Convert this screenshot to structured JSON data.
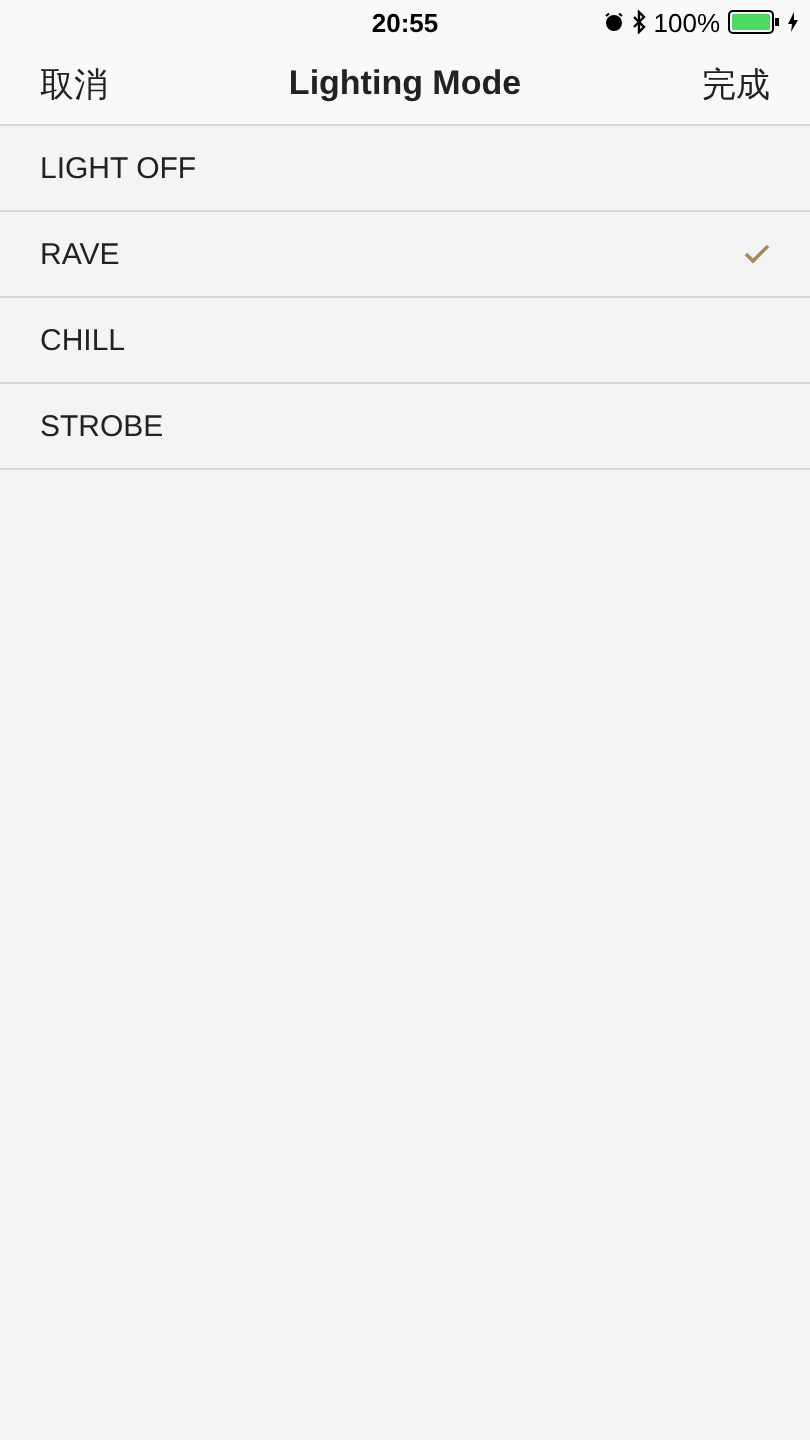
{
  "status_bar": {
    "time": "20:55",
    "battery": "100%",
    "alarm": true,
    "bluetooth": true,
    "charging": true
  },
  "nav": {
    "cancel": "取消",
    "title": "Lighting Mode",
    "done": "完成"
  },
  "modes": [
    {
      "label": "LIGHT OFF",
      "selected": false
    },
    {
      "label": "RAVE",
      "selected": true
    },
    {
      "label": "CHILL",
      "selected": false
    },
    {
      "label": "STROBE",
      "selected": false
    }
  ]
}
